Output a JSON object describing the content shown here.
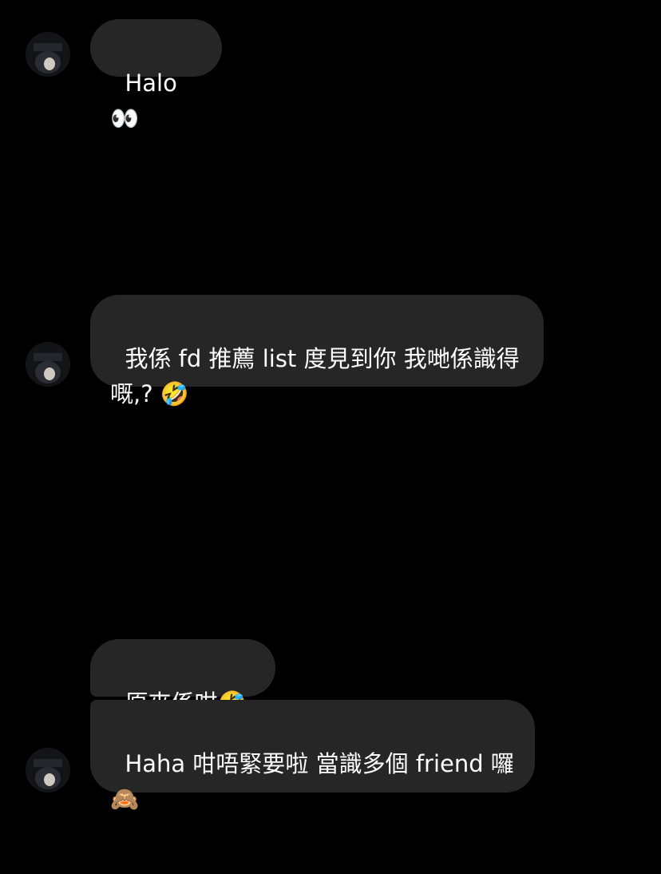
{
  "colors": {
    "background": "#000000",
    "bubble": "#262626",
    "text": "#ffffff"
  },
  "messages": [
    {
      "text": "Halo👀",
      "avatar": "contact-avatar"
    },
    {
      "text": "我係 fd 推薦 list 度見到你 我哋係識得嘅,? 🤣",
      "avatar": "contact-avatar"
    },
    {
      "text": "原來係咁🤣",
      "avatar": ""
    },
    {
      "text": "Haha 咁唔緊要啦 當識多個 friend 囉🙈",
      "avatar": "contact-avatar"
    }
  ]
}
